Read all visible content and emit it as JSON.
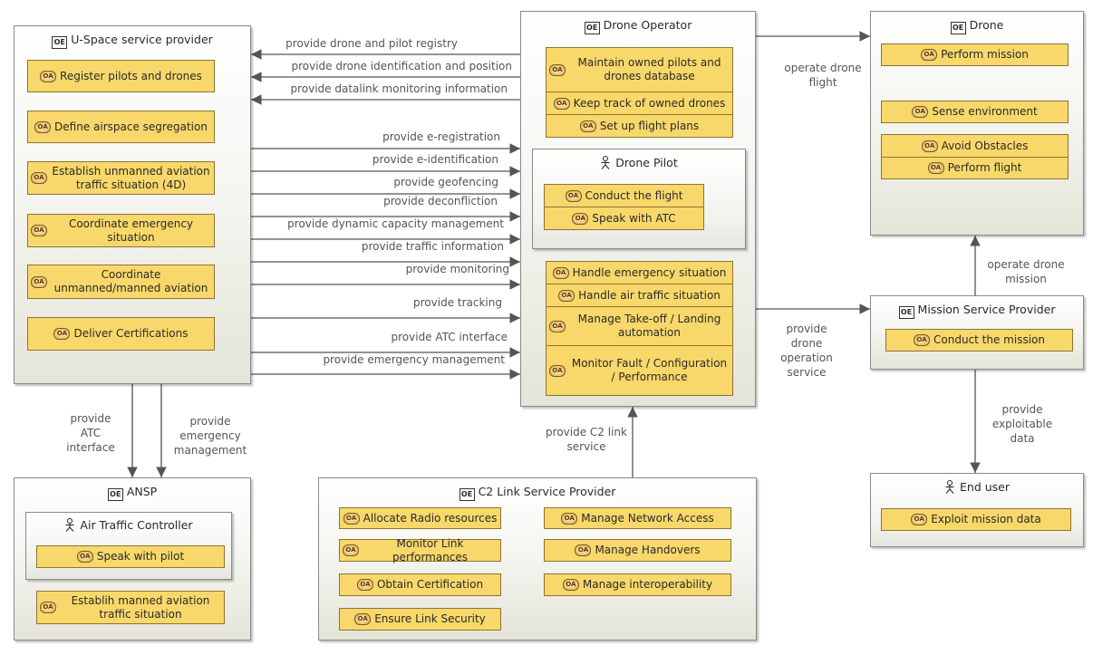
{
  "colors": {
    "function_fill": "#f8d86a",
    "function_border": "#8c7434",
    "edge": "#555555"
  },
  "components": [
    {
      "name": "U-Space service provider",
      "icon": "operational-entity-icon",
      "functions": [
        "Register pilots and drones",
        "Define airspace segregation",
        "Establish unmanned aviation traffic situation (4D)",
        "Coordinate emergency situation",
        "Coordinate unmanned/manned aviation",
        "Deliver Certifications"
      ],
      "actors": []
    },
    {
      "name": "Drone Operator",
      "icon": "operational-entity-icon",
      "functions": [
        "Maintain owned pilots and drones database",
        "Keep track of owned drones",
        "Set up flight plans",
        "Handle emergency situation",
        "Handle air traffic situation",
        "Manage Take-off / Landing automation",
        "Monitor Fault / Configuration / Performance"
      ],
      "actors": [
        {
          "name": "Drone Pilot",
          "icon": "actor-icon",
          "functions": [
            "Conduct the flight",
            "Speak with ATC"
          ]
        }
      ]
    },
    {
      "name": "Drone",
      "icon": "operational-entity-icon",
      "functions": [
        "Perform mission",
        "Sense environment",
        "Avoid Obstacles",
        "Perform flight"
      ],
      "actors": []
    },
    {
      "name": "Mission Service Provider",
      "icon": "operational-entity-icon",
      "functions": [
        "Conduct the mission"
      ],
      "actors": []
    },
    {
      "name": "End user",
      "icon": "actor-icon",
      "functions": [
        "Exploit mission data"
      ],
      "actors": []
    },
    {
      "name": "ANSP",
      "icon": "operational-entity-icon",
      "functions": [
        "Establih manned aviation traffic situation"
      ],
      "actors": [
        {
          "name": "Air Traffic Controller",
          "icon": "actor-icon",
          "functions": [
            "Speak with pilot"
          ]
        }
      ]
    },
    {
      "name": "C2 Link Service Provider",
      "icon": "operational-entity-icon",
      "functions": [
        "Allocate Radio resources",
        "Monitor Link performances",
        "Obtain Certification",
        "Ensure Link Security",
        "Manage Network Access",
        "Manage Handovers",
        "Manage interoperability"
      ],
      "actors": []
    }
  ],
  "edges": [
    {
      "label": "provide drone and pilot registry",
      "from": "Drone Operator",
      "to": "U-Space service provider"
    },
    {
      "label": "provide drone identification and position",
      "from": "Drone Operator",
      "to": "U-Space service provider"
    },
    {
      "label": "provide datalink monitoring information",
      "from": "Drone Operator",
      "to": "U-Space service provider"
    },
    {
      "label": "provide e-registration",
      "from": "U-Space service provider",
      "to": "Drone Operator"
    },
    {
      "label": "provide e-identification",
      "from": "U-Space service provider",
      "to": "Drone Operator"
    },
    {
      "label": "provide geofencing",
      "from": "U-Space service provider",
      "to": "Drone Operator"
    },
    {
      "label": "provide deconfliction",
      "from": "U-Space service provider",
      "to": "Drone Operator"
    },
    {
      "label": "provide dynamic capacity management",
      "from": "U-Space service provider",
      "to": "Drone Operator"
    },
    {
      "label": "provide traffic information",
      "from": "U-Space service provider",
      "to": "Drone Operator"
    },
    {
      "label": "provide monitoring",
      "from": "U-Space service provider",
      "to": "Drone Operator"
    },
    {
      "label": "provide tracking",
      "from": "U-Space service provider",
      "to": "Drone Operator"
    },
    {
      "label": "provide ATC interface",
      "from": "U-Space service provider",
      "to": "Drone Operator"
    },
    {
      "label": "provide emergency management",
      "from": "U-Space service provider",
      "to": "Drone Operator"
    },
    {
      "label": "operate drone flight",
      "from": "Drone Operator",
      "to": "Drone"
    },
    {
      "label": "provide drone operation service",
      "from": "Drone Operator",
      "to": "Mission Service Provider"
    },
    {
      "label": "operate drone mission",
      "from": "Mission Service Provider",
      "to": "Drone"
    },
    {
      "label": "provide exploitable data",
      "from": "Mission Service Provider",
      "to": "End user"
    },
    {
      "label": "provide C2 link service",
      "from": "C2 Link Service Provider",
      "to": "Drone Operator"
    },
    {
      "label": "provide ATC interface",
      "from": "U-Space service provider",
      "to": "ANSP"
    },
    {
      "label": "provide emergency management",
      "from": "U-Space service provider",
      "to": "ANSP"
    }
  ]
}
